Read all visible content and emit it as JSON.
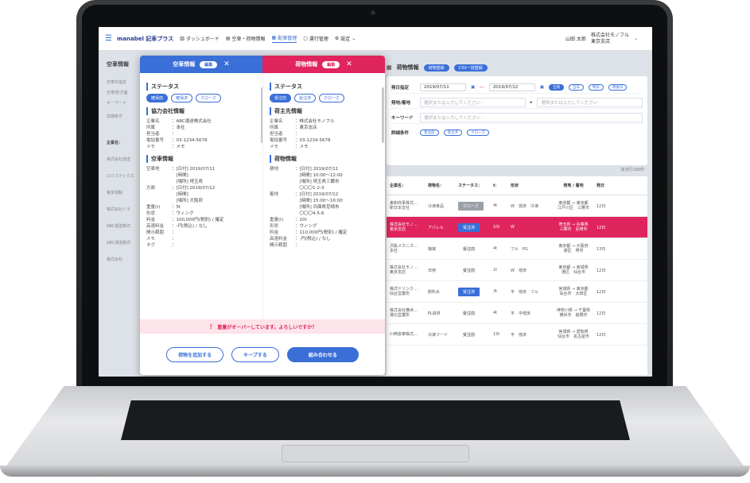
{
  "app": {
    "logo": "manabel 記車プラス",
    "nav": [
      "ダッシュボード",
      "空車・荷物情報",
      "配車管理",
      "運行管理",
      "設定"
    ],
    "user_name": "山田 太郎",
    "company_line1": "株式会社モノフル",
    "company_line2": "東京支店"
  },
  "left_col": {
    "title": "空車情報",
    "items": [
      "空車日指定",
      "空車地/方面",
      "キーワード",
      "詳細条件",
      "企業名：",
      "株式会社運送",
      "ロジスティクス",
      "東京運輸",
      "株式会社トラ",
      "ABC運送株式",
      "ABC運送株式",
      "株式会社"
    ]
  },
  "modal": {
    "left_header": "空車情報",
    "right_header": "荷物情報",
    "tag": "編集",
    "left": {
      "status_title": "ステータス",
      "status_chips": [
        "確保前",
        "確保済",
        "クローズ"
      ],
      "partner_title": "協力会社情報",
      "partner": [
        {
          "k": "企業名",
          "v": "：ABC運送株式会社"
        },
        {
          "k": "所属",
          "v": "：本社"
        },
        {
          "k": "担当者",
          "v": "："
        },
        {
          "k": "電話番号",
          "v": "：03-1234-5678"
        },
        {
          "k": "メモ",
          "v": "：メモ"
        }
      ],
      "vehicle_title": "空車情報",
      "vehicle": [
        {
          "k": "空車地",
          "v": "：[日付] 2019/07/11\n　[時間]\n　[場所] 埼玉県"
        },
        {
          "k": "方面",
          "v": "：[日付] 2019/07/12\n　[時間]\n　[場所] 大阪府"
        },
        {
          "k": "重量(t)",
          "v": "：5t"
        },
        {
          "k": "形状",
          "v": "：ウィング"
        },
        {
          "k": "料金",
          "v": "：100,000円(税別) / 確定"
        },
        {
          "k": "高速料金",
          "v": "：-円(税込) / なし"
        },
        {
          "k": "開示範囲",
          "v": "："
        },
        {
          "k": "メモ",
          "v": "："
        },
        {
          "k": "タグ",
          "v": "："
        }
      ]
    },
    "right": {
      "status_title": "ステータス",
      "status_chips": [
        "受注前",
        "受注済",
        "クローズ"
      ],
      "shipper_title": "荷主先情報",
      "shipper": [
        {
          "k": "企業名",
          "v": "：株式会社モノフル"
        },
        {
          "k": "所属",
          "v": "：東京支店"
        },
        {
          "k": "担当者",
          "v": "："
        },
        {
          "k": "電話番号",
          "v": "：03-1234-5678"
        },
        {
          "k": "メモ",
          "v": "：メモ"
        }
      ],
      "cargo_title": "荷物情報",
      "cargo": [
        {
          "k": "積地",
          "v": "：[日付] 2019/07/11\n　[時間] 10:00〜12:00\n　[場所] 埼玉県三郷市\n　〇〇〇1-2-3"
        },
        {
          "k": "着地",
          "v": "：[日付] 2019/07/12\n　[時間] 15:00〜16:00\n　[場所] 兵庫県尼崎市\n　〇〇〇4-5-6"
        },
        {
          "k": "重量(t)",
          "v": "：10t"
        },
        {
          "k": "形状",
          "v": "：ウィング"
        },
        {
          "k": "料金",
          "v": "：110,000円(税別) / 確定"
        },
        {
          "k": "高速料金",
          "v": "：-円(税込) / なし"
        },
        {
          "k": "開示範囲",
          "v": "："
        }
      ]
    },
    "warning": "重量がオーバーしています。よろしいですか？",
    "btn_add": "荷物を追加する",
    "btn_keep": "キープする",
    "btn_match": "組み合わせる"
  },
  "right_panel": {
    "title": "荷物情報",
    "pill1": "荷物登録",
    "pill2": "CSV一括登録",
    "date_label": "発日指定",
    "date_from": "2019/07/11",
    "date_to": "2019/07/12",
    "date_chips": [
      "全期",
      "当日",
      "明日",
      "明後日"
    ],
    "route_label": "発地/着地",
    "route_ph": "選択または入力してください",
    "keyword_label": "キーワード",
    "keyword_ph": "選択または入力してください",
    "detail_label": "詳細条件",
    "detail_chips": [
      "受注前",
      "受注済",
      "クローズ"
    ],
    "count": "該当行100件",
    "columns": [
      "企業名：",
      "荷物名：",
      "ステータス：",
      "t：",
      "形状",
      "発地 / 着地",
      "発日"
    ],
    "rows": [
      {
        "company": "東和商事株式…\n新日本支社",
        "item": "冷凍食品",
        "status": "クローズ",
        "st": "grey",
        "t": "4t",
        "shape": "W　低床　冷凍",
        "route": "東京都 → 東京都\n江戸川区　三鷹市",
        "day": "12日"
      },
      {
        "company": "株式会社モノ…\n東京支店",
        "item": "アパレル",
        "status": "受注済",
        "st": "blue",
        "t": "10t",
        "shape": "W",
        "route": "埼玉県 → 兵庫県\n三郷市　尼崎市",
        "day": "12日"
      },
      {
        "company": "沢鉱メカニカ…\n本社",
        "item": "機械",
        "status": "受注前",
        "st": "none",
        "t": "4t",
        "shape": "フル　PG",
        "route": "東京都 → 大阪府\n港区　堺市",
        "day": "13日"
      },
      {
        "company": "株式会社モノ…\n東京支店",
        "item": "日用",
        "status": "受注前",
        "st": "none",
        "t": "1t",
        "shape": "W　低床",
        "route": "東京都 → 宮城県\n港区　仙台市",
        "day": "12日"
      },
      {
        "company": "株式ドリンク…\n仙台営業所",
        "item": "飲料水",
        "status": "受注済",
        "st": "blue",
        "t": "3t",
        "shape": "平　低床　フル",
        "route": "宮城県 → 東京都\n仙台市　大田区",
        "day": "12日"
      },
      {
        "company": "株式会社横浜…\n港北営業所",
        "item": "PL資材",
        "status": "受注前",
        "st": "none",
        "t": "4t",
        "shape": "平　中低床",
        "route": "神奈川県 → 千葉県\n横浜市　船橋市",
        "day": "12日"
      },
      {
        "company": "川崎倉庫株式…",
        "item": "冷凍フード",
        "status": "受注前",
        "st": "none",
        "t": "13t",
        "shape": "平　低床",
        "route": "宮城県 → 愛知県\n仙台市　名古屋市",
        "day": "12日"
      }
    ]
  }
}
